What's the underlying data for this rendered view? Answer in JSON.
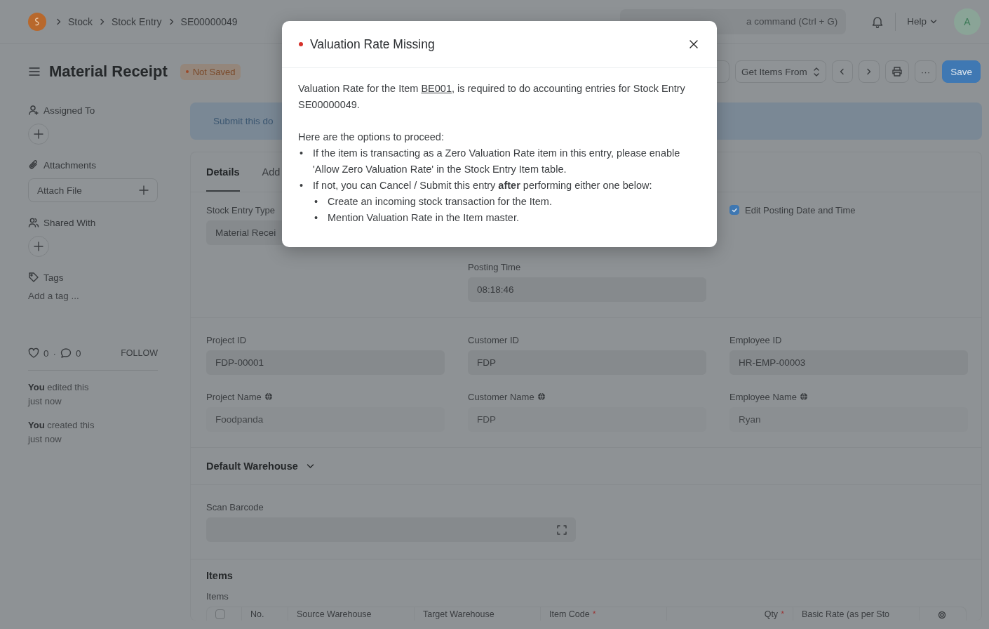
{
  "navbar": {
    "breadcrumbs": [
      "Stock",
      "Stock Entry",
      "SE00000049"
    ],
    "search": {
      "placeholder": "a command (Ctrl + G)"
    },
    "help": "Help",
    "avatar": "A"
  },
  "page_head": {
    "title": "Material Receipt",
    "status": "Not Saved",
    "get_items": "Get Items From",
    "more": "···",
    "save": "Save"
  },
  "sidebar": {
    "sections": [
      {
        "kind": "assign",
        "title": "Assigned To"
      },
      {
        "kind": "attach",
        "title": "Attachments",
        "button": "Attach File"
      },
      {
        "kind": "share",
        "title": "Shared With"
      },
      {
        "kind": "tags",
        "title": "Tags",
        "placeholder": "Add a tag ..."
      }
    ],
    "likes": "0",
    "separator": "·",
    "comments": "0",
    "follow": "FOLLOW",
    "activity": [
      {
        "text": "**You** edited this just now"
      },
      {
        "text": "**You** created this just now"
      }
    ]
  },
  "banner": "Submit this do",
  "tabs": [
    {
      "label": "Details",
      "selected": true
    },
    {
      "label": "Add",
      "selected": false
    }
  ],
  "details": {
    "stock_entry_type": {
      "label": "Stock Entry Type",
      "value": "Material Recei"
    },
    "posting_time": {
      "label": "Posting Time",
      "value": "08:18:46"
    },
    "edit_posting": {
      "label": "Edit Posting Date and Time",
      "checked": true
    }
  },
  "reference_fields": [
    {
      "label": "Project ID",
      "value": "FDP-00001",
      "fetched": false
    },
    {
      "label": "Customer ID",
      "value": "FDP",
      "fetched": false
    },
    {
      "label": "Employee ID",
      "value": "HR-EMP-00003",
      "fetched": false
    },
    {
      "label": "Project Name",
      "value": "Foodpanda",
      "fetched": true
    },
    {
      "label": "Customer Name",
      "value": "FDP",
      "fetched": true
    },
    {
      "label": "Employee Name",
      "value": "Ryan",
      "fetched": true
    }
  ],
  "default_warehouse": {
    "title": "Default Warehouse",
    "expanded": false
  },
  "scan_barcode": {
    "label": "Scan Barcode"
  },
  "items": {
    "title": "Items",
    "label": "Items",
    "select_all_checked": false,
    "columns": [
      {
        "label": "No."
      },
      {
        "label": "Source Warehouse"
      },
      {
        "label": "Target Warehouse"
      },
      {
        "label": "Item Code",
        "mark": "*"
      },
      {
        "label": "Qty",
        "mark": "*"
      },
      {
        "label": "Basic Rate (as per Sto"
      }
    ]
  },
  "modal": {
    "title": "Valuation Rate Missing",
    "text_before": "Valuation Rate for the Item ",
    "item_link": "BE001",
    "text_after": ", is required to do accounting entries for Stock Entry SE00000049.",
    "options_heading": "Here are the options to proceed:",
    "options": [
      {
        "marker": "•",
        "text": "If the item is transacting as a Zero Valuation Rate item in this entry, please enable 'Allow Zero Valuation Rate' in the Stock Entry Item table."
      },
      {
        "marker": "•",
        "text": "If not, you can Cancel / Submit this entry **after** performing either one below:",
        "children": [
          {
            "marker": "•",
            "text": "Create an incoming stock transaction for the Item."
          },
          {
            "marker": "•",
            "text": "Mention Valuation Rate in the Item master."
          }
        ]
      }
    ]
  }
}
